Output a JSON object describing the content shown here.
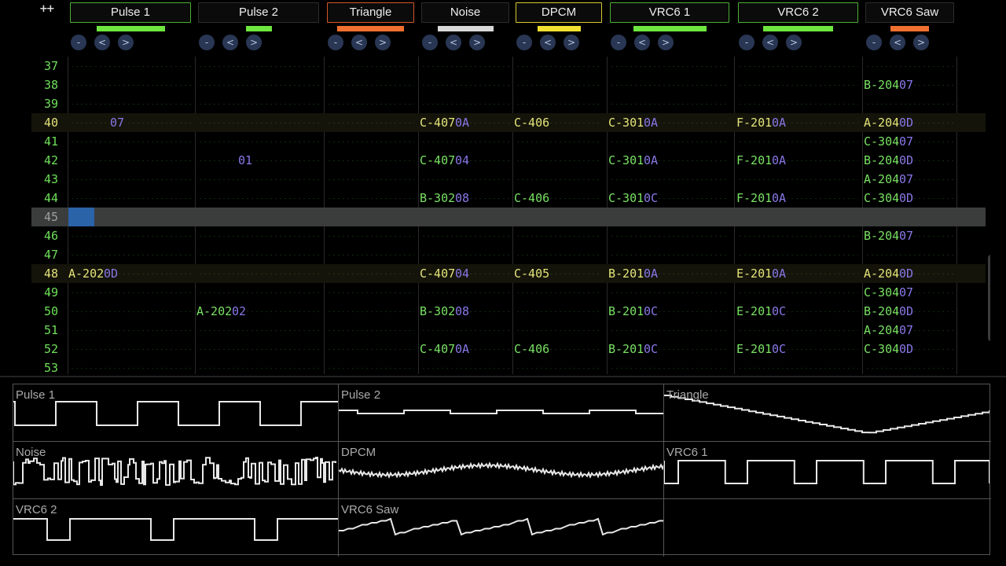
{
  "header": {
    "expand_label": "++",
    "channels": [
      {
        "name": "Pulse 1",
        "color": "#4caf35",
        "bar_color": "#6fe640",
        "bar_level": 0.68
      },
      {
        "name": "Pulse 2",
        "color": "#2c2c2c",
        "bar_color": "#6fe640",
        "bar_level": 0.26
      },
      {
        "name": "Triangle",
        "color": "#d4552a",
        "bar_color": "#f07030",
        "bar_level": 1.0
      },
      {
        "name": "Noise",
        "color": "#2c2c2c",
        "bar_color": "#d8d8d8",
        "bar_level": 0.82
      },
      {
        "name": "DPCM",
        "color": "#d8c830",
        "bar_color": "#f0e030",
        "bar_level": 0.66
      },
      {
        "name": "VRC6 1",
        "color": "#4caf35",
        "bar_color": "#6fe640",
        "bar_level": 0.74
      },
      {
        "name": "VRC6 2",
        "color": "#4caf35",
        "bar_color": "#6fe640",
        "bar_level": 0.7
      },
      {
        "name": "VRC6 Saw",
        "color": "#2c2c2c",
        "bar_color": "#f07030",
        "bar_level": 0.56
      }
    ],
    "button_labels": [
      "-",
      "<",
      ">"
    ]
  },
  "pattern": {
    "cursor_row": "45",
    "rows": [
      {
        "num": "37",
        "cells": []
      },
      {
        "num": "38",
        "cells": [
          {
            "col": 7,
            "note": "B-204",
            "ins": "07"
          }
        ]
      },
      {
        "num": "39",
        "cells": []
      },
      {
        "num": "40",
        "hl": true,
        "cells": [
          {
            "col": 0,
            "note": "",
            "ins": "07"
          },
          {
            "col": 3,
            "note": "C-407",
            "ins": "0A"
          },
          {
            "col": 4,
            "note": "C-406",
            "ins": ""
          },
          {
            "col": 5,
            "note": "C-301",
            "ins": "0A"
          },
          {
            "col": 6,
            "note": "F-201",
            "ins": "0A"
          },
          {
            "col": 7,
            "note": "A-204",
            "ins": "0D"
          }
        ]
      },
      {
        "num": "41",
        "cells": [
          {
            "col": 7,
            "note": "C-304",
            "ins": "07"
          }
        ]
      },
      {
        "num": "42",
        "cells": [
          {
            "col": 1,
            "note": "",
            "ins": "01"
          },
          {
            "col": 3,
            "note": "C-407",
            "ins": "04"
          },
          {
            "col": 5,
            "note": "C-301",
            "ins": "0A"
          },
          {
            "col": 6,
            "note": "F-201",
            "ins": "0A"
          },
          {
            "col": 7,
            "note": "B-204",
            "ins": "0D"
          }
        ]
      },
      {
        "num": "43",
        "cells": [
          {
            "col": 7,
            "note": "A-204",
            "ins": "07"
          }
        ]
      },
      {
        "num": "44",
        "cells": [
          {
            "col": 3,
            "note": "B-302",
            "ins": "08"
          },
          {
            "col": 4,
            "note": "C-406",
            "ins": ""
          },
          {
            "col": 5,
            "note": "C-301",
            "ins": "0C"
          },
          {
            "col": 6,
            "note": "F-201",
            "ins": "0A"
          },
          {
            "col": 7,
            "note": "C-304",
            "ins": "0D"
          }
        ]
      },
      {
        "num": "45",
        "cursor": true,
        "cells": []
      },
      {
        "num": "46",
        "cells": [
          {
            "col": 7,
            "note": "B-204",
            "ins": "07"
          }
        ]
      },
      {
        "num": "47",
        "cells": []
      },
      {
        "num": "48",
        "hl": true,
        "cells": [
          {
            "col": 0,
            "note": "A-202",
            "ins": "0D"
          },
          {
            "col": 3,
            "note": "C-407",
            "ins": "04"
          },
          {
            "col": 4,
            "note": "C-405",
            "ins": ""
          },
          {
            "col": 5,
            "note": "B-201",
            "ins": "0A"
          },
          {
            "col": 6,
            "note": "E-201",
            "ins": "0A"
          },
          {
            "col": 7,
            "note": "A-204",
            "ins": "0D"
          }
        ]
      },
      {
        "num": "49",
        "cells": [
          {
            "col": 7,
            "note": "C-304",
            "ins": "07"
          }
        ]
      },
      {
        "num": "50",
        "cells": [
          {
            "col": 1,
            "note": "A-202",
            "ins": "02"
          },
          {
            "col": 3,
            "note": "B-302",
            "ins": "08"
          },
          {
            "col": 5,
            "note": "B-201",
            "ins": "0C"
          },
          {
            "col": 6,
            "note": "E-201",
            "ins": "0C"
          },
          {
            "col": 7,
            "note": "B-204",
            "ins": "0D"
          }
        ]
      },
      {
        "num": "51",
        "cells": [
          {
            "col": 7,
            "note": "A-204",
            "ins": "07"
          }
        ]
      },
      {
        "num": "52",
        "cells": [
          {
            "col": 3,
            "note": "C-407",
            "ins": "0A"
          },
          {
            "col": 4,
            "note": "C-406",
            "ins": ""
          },
          {
            "col": 5,
            "note": "B-201",
            "ins": "0C"
          },
          {
            "col": 6,
            "note": "E-201",
            "ins": "0C"
          },
          {
            "col": 7,
            "note": "C-304",
            "ins": "0D"
          }
        ]
      },
      {
        "num": "53",
        "cells": []
      }
    ]
  },
  "scopes": [
    {
      "label": "Pulse 1",
      "wave": "pulse1"
    },
    {
      "label": "Pulse 2",
      "wave": "pulse2"
    },
    {
      "label": "Triangle",
      "wave": "triangle"
    },
    {
      "label": "Noise",
      "wave": "noise"
    },
    {
      "label": "DPCM",
      "wave": "dpcm"
    },
    {
      "label": "VRC6 1",
      "wave": "vrc61"
    },
    {
      "label": "VRC6 2",
      "wave": "vrc62"
    },
    {
      "label": "VRC6 Saw",
      "wave": "saw"
    },
    {
      "label": "",
      "wave": "none"
    }
  ]
}
